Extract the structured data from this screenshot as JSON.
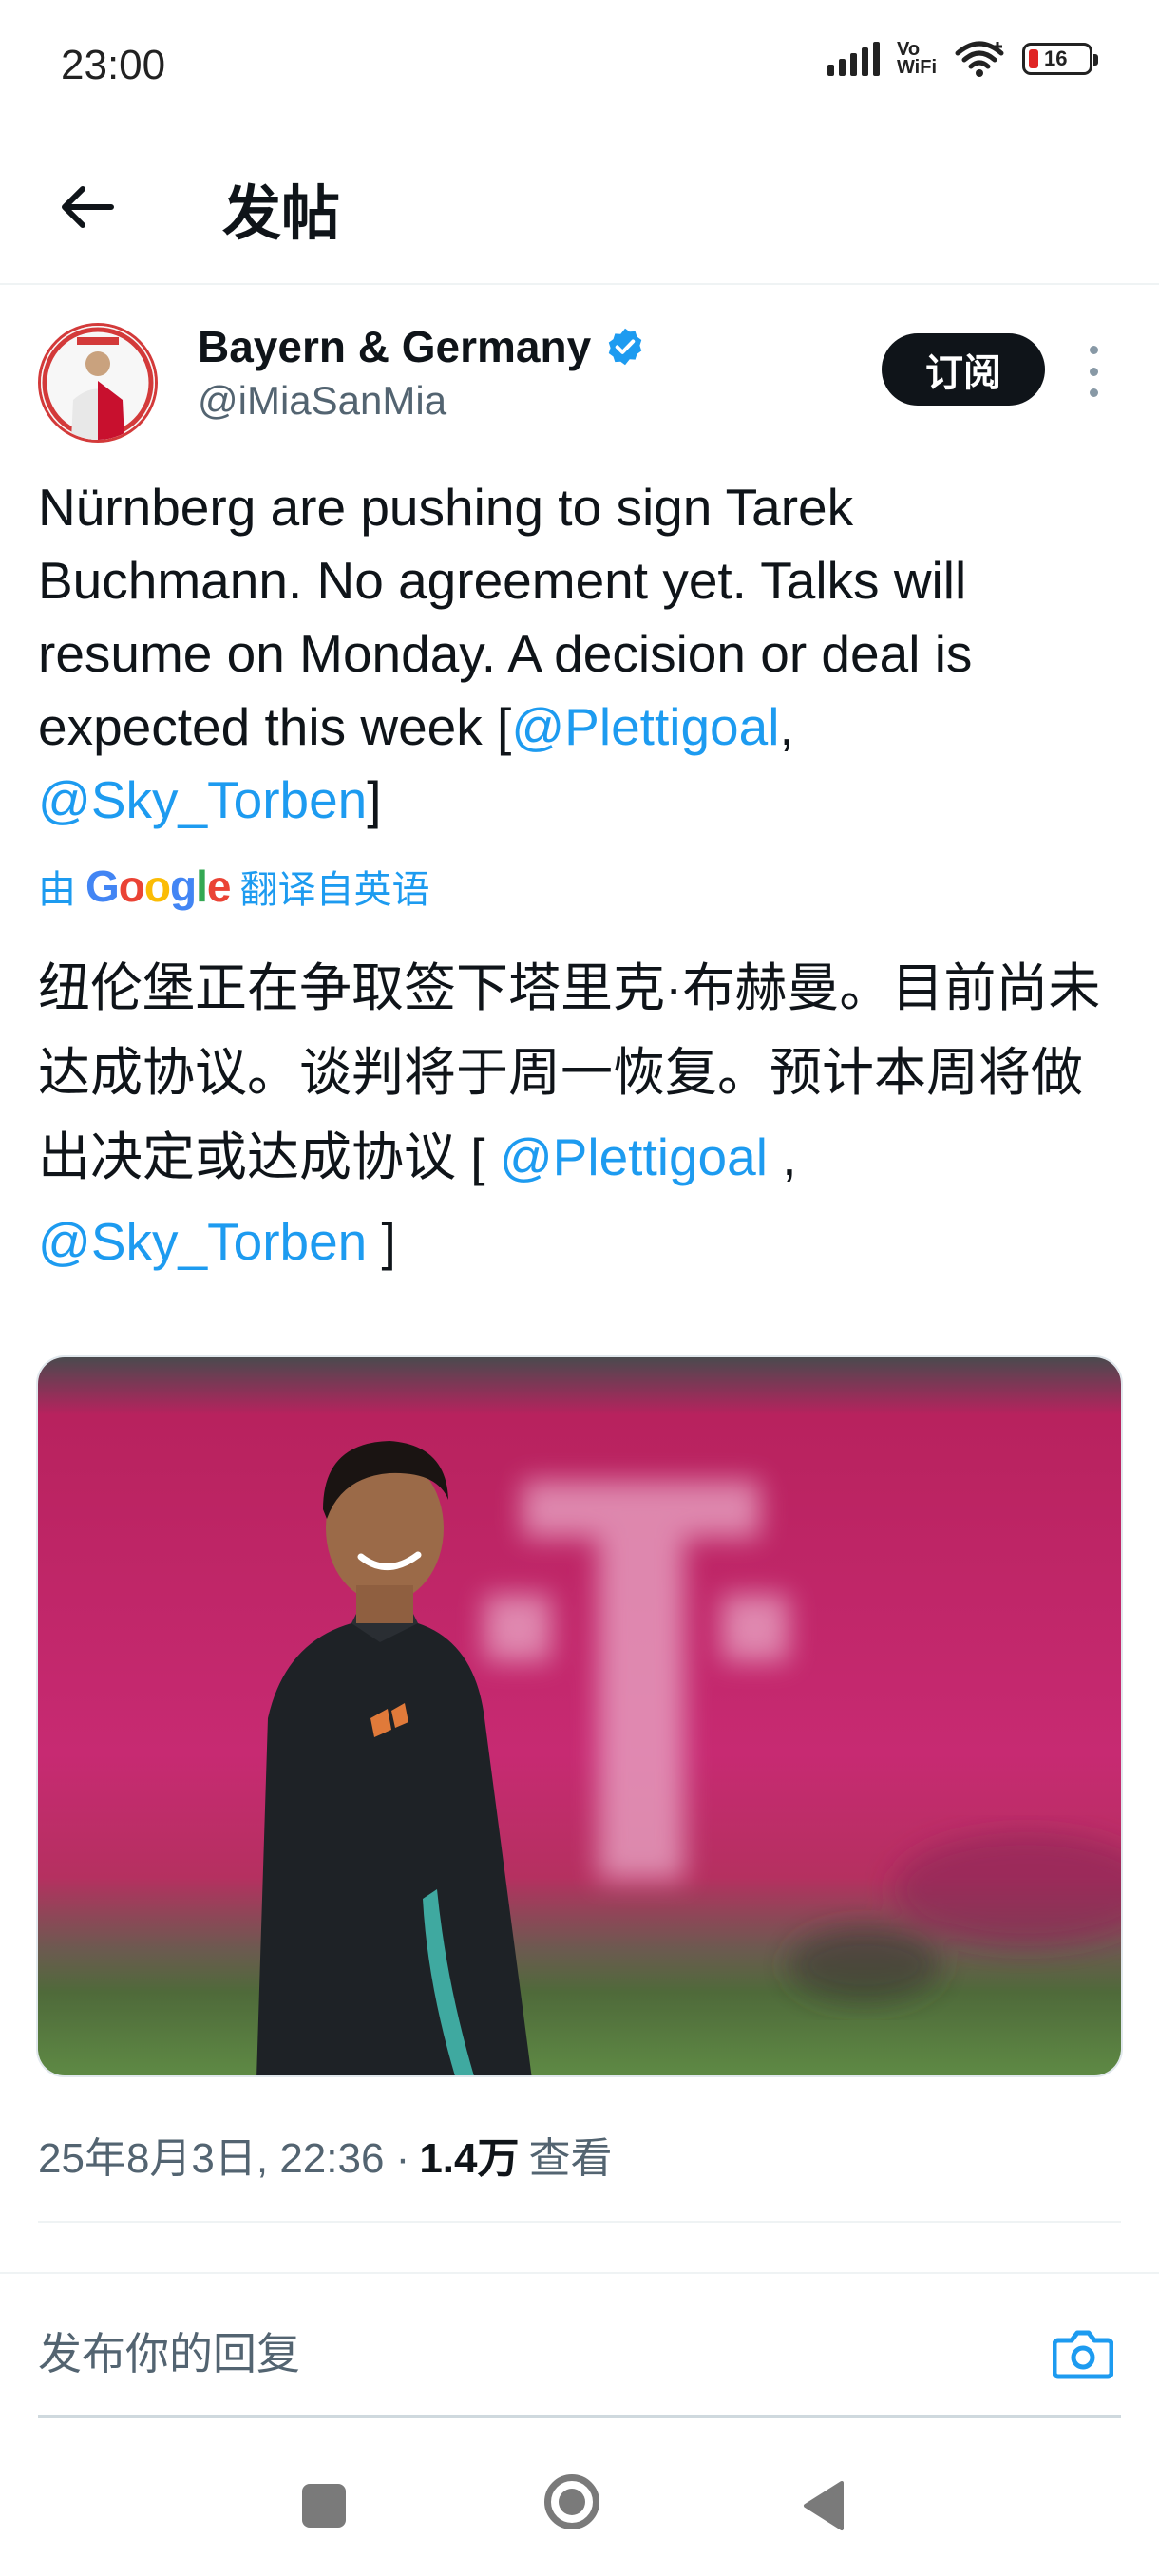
{
  "status_bar": {
    "time": "23:00",
    "network_label_top": "Vo",
    "network_label_bottom": "WiFi",
    "battery_level": "16"
  },
  "header": {
    "title": "发帖"
  },
  "post": {
    "author_name": "Bayern & Germany",
    "author_handle": "@iMiaSanMia",
    "subscribe_label": "订阅",
    "text_before": "Nürnberg are pushing to sign Tarek Buchmann. No agreement yet. Talks will resume on Monday. A decision or deal is expected this week [",
    "mention_1": "@Plettigoal",
    "text_between": ",",
    "mention_2": "@Sky_Torben",
    "text_after": "]",
    "translate_prefix": "由",
    "translate_google_g": "G",
    "translate_google_o1": "o",
    "translate_google_o2": "o",
    "translate_google_g2": "g",
    "translate_google_l": "l",
    "translate_google_e": "e",
    "translate_suffix": "翻译自英语",
    "translated_before": "纽伦堡正在争取签下塔里克·布赫曼。目前尚未达成协议。谈判将于周一恢复。预计本周将做出决定或达成协议 [ ",
    "translated_mention_1": "@Plettigoal",
    "translated_between": " ,",
    "translated_mention_2": "@Sky_Torben",
    "translated_after": " ]",
    "date_time": "25年8月3日, 22:36 ·",
    "views_count": "1.4万",
    "views_label": "查看"
  },
  "reply": {
    "placeholder": "发布你的回复"
  },
  "icons": {
    "back": "arrow-left-icon",
    "verified": "verified-badge-icon",
    "more": "more-vertical-icon",
    "camera": "camera-icon"
  },
  "colors": {
    "accent": "#1d9bf0",
    "text_primary": "#0f1419",
    "text_secondary": "#536471",
    "image_background": "#c2286f"
  }
}
